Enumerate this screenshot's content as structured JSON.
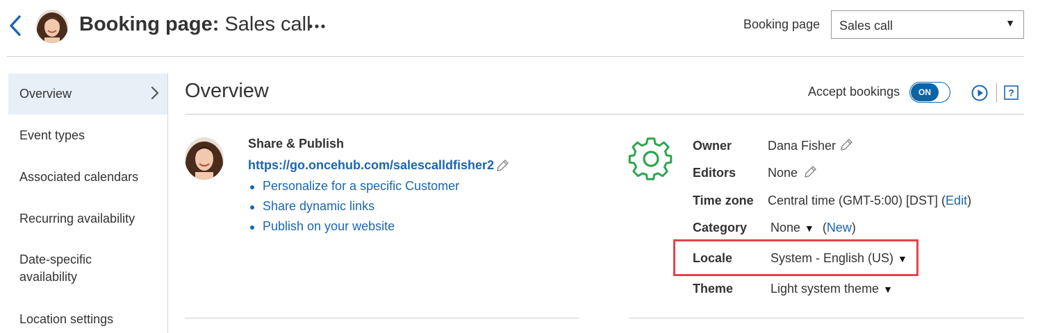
{
  "header": {
    "title_bold": "Booking page:",
    "title_rest": " Sales call",
    "select_label": "Booking page",
    "select_value": "Sales call"
  },
  "sidebar": {
    "items": [
      {
        "label": "Overview",
        "active": true
      },
      {
        "label": "Event types"
      },
      {
        "label": "Associated calendars"
      },
      {
        "label": "Recurring availability"
      },
      {
        "label": "Date-specific availability"
      },
      {
        "label": "Location settings"
      }
    ]
  },
  "main": {
    "title": "Overview",
    "accept_label": "Accept bookings",
    "toggle_label": "ON",
    "help_label": "?"
  },
  "share": {
    "title": "Share & Publish",
    "url": "https://go.oncehub.com/salescalldfisher2",
    "links": [
      "Personalize for a specific Customer",
      "Share dynamic links",
      "Publish on your website"
    ]
  },
  "properties": {
    "owner_label": "Owner",
    "owner_value": "Dana Fisher",
    "editors_label": "Editors",
    "editors_value": "None",
    "timezone_label": "Time zone",
    "timezone_value": "Central time (GMT-5:00) [DST] (",
    "timezone_edit": "Edit",
    "timezone_close": ")",
    "category_label": "Category",
    "category_value": "None",
    "category_new_open": "(",
    "category_new": "New",
    "category_new_close": ")",
    "locale_label": "Locale",
    "locale_value": "System - English (US)",
    "theme_label": "Theme",
    "theme_value": "Light system theme"
  },
  "colors": {
    "accent": "#1a66b0",
    "toggle_on": "#0b64a8",
    "gear": "#2ea44f",
    "highlight": "#e5434b",
    "sidebar_active": "#e8eff7"
  },
  "icons": [
    "back-arrow-icon",
    "more-dots-icon",
    "chevron-right-icon",
    "play-icon",
    "help-icon",
    "pencil-icon",
    "gear-icon",
    "dropdown-arrow-icon"
  ]
}
